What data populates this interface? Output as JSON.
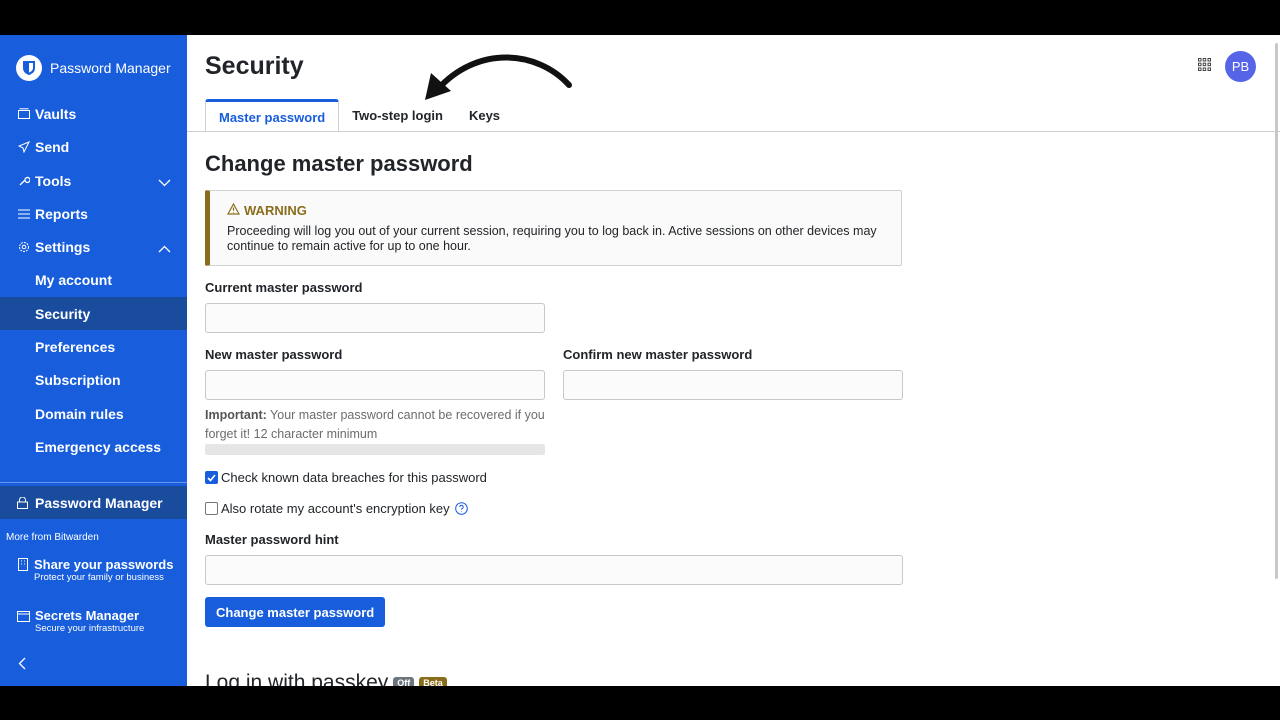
{
  "app": {
    "name": "Password Manager"
  },
  "sidebar": {
    "items": [
      {
        "label": "Vaults"
      },
      {
        "label": "Send"
      },
      {
        "label": "Tools"
      },
      {
        "label": "Reports"
      },
      {
        "label": "Settings"
      }
    ],
    "settings_sub": [
      {
        "label": "My account"
      },
      {
        "label": "Security"
      },
      {
        "label": "Preferences"
      },
      {
        "label": "Subscription"
      },
      {
        "label": "Domain rules"
      },
      {
        "label": "Emergency access"
      }
    ],
    "active_product": "Password Manager",
    "more_label": "More from Bitwarden",
    "products": [
      {
        "title": "Share your passwords",
        "subtitle": "Protect your family or business"
      },
      {
        "title": "Secrets Manager",
        "subtitle": "Secure your infrastructure"
      }
    ]
  },
  "header": {
    "title": "Security",
    "avatar_initials": "PB",
    "tabs": [
      {
        "label": "Master password"
      },
      {
        "label": "Two-step login"
      },
      {
        "label": "Keys"
      }
    ]
  },
  "form": {
    "heading": "Change master password",
    "warning_title": "WARNING",
    "warning_text": "Proceeding will log you out of your current session, requiring you to log back in. Active sessions on other devices may continue to remain active for up to one hour.",
    "current_label": "Current master password",
    "new_label": "New master password",
    "confirm_label": "Confirm new master password",
    "hint_strong": "Important:",
    "hint_text": " Your master password cannot be recovered if you forget it! 12 character minimum",
    "check_breaches_label": "Check known data breaches for this password",
    "rotate_key_label": "Also rotate my account's encryption key",
    "hint_label": "Master password hint",
    "submit_label": "Change master password"
  },
  "passkey": {
    "heading": "Log in with passkey",
    "badge_off": "Off",
    "badge_beta": "Beta"
  },
  "colors": {
    "sidebar": "#175ddc",
    "active_nav": "#1a4c9e",
    "warning": "#8a6d1c",
    "avatar": "#5665e8"
  }
}
